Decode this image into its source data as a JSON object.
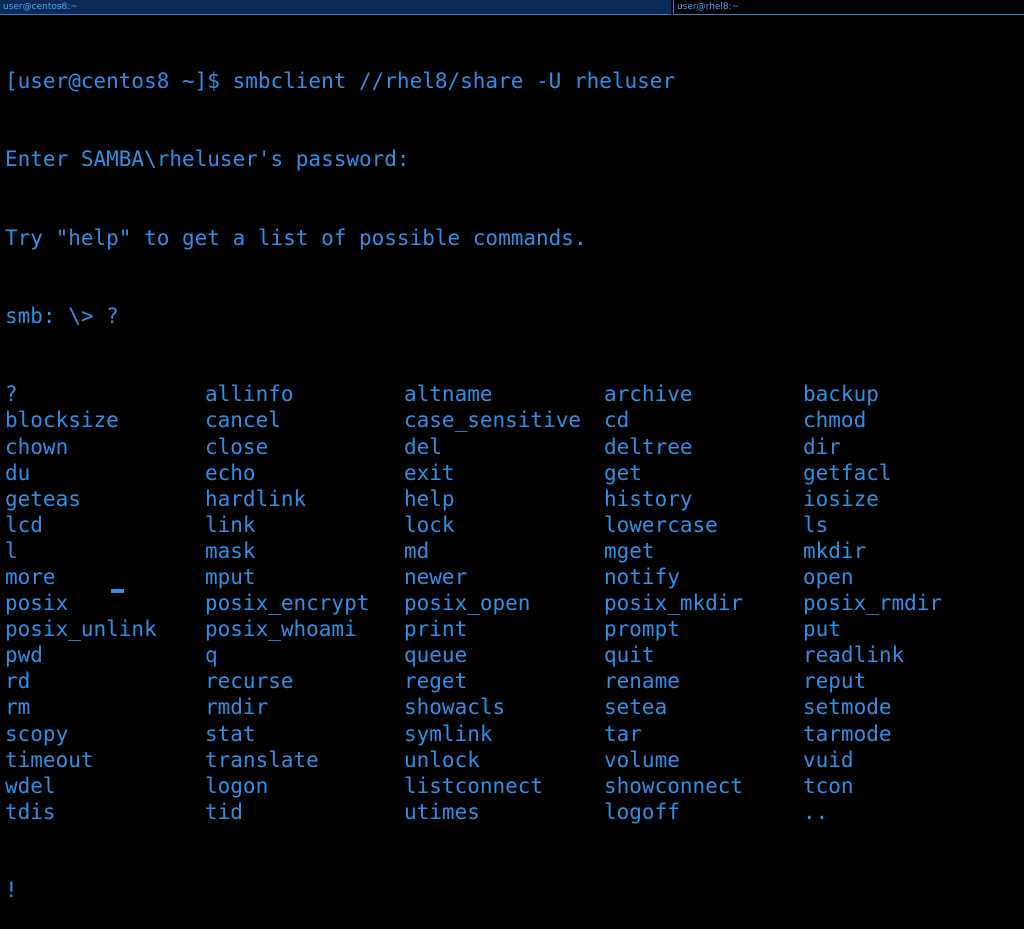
{
  "tabs": [
    {
      "label": "user@centos8:~",
      "active": true
    },
    {
      "label": "user@rhel8:~",
      "active": false
    }
  ],
  "terminal": {
    "lines": [
      "[user@centos8 ~]$ smbclient //rhel8/share -U rheluser",
      "Enter SAMBA\\rheluser's password:",
      "Try \"help\" to get a list of possible commands.",
      "smb: \\> ?"
    ],
    "commands": [
      [
        "?",
        "allinfo",
        "altname",
        "archive",
        "backup"
      ],
      [
        "blocksize",
        "cancel",
        "case_sensitive",
        "cd",
        "chmod"
      ],
      [
        "chown",
        "close",
        "del",
        "deltree",
        "dir"
      ],
      [
        "du",
        "echo",
        "exit",
        "get",
        "getfacl"
      ],
      [
        "geteas",
        "hardlink",
        "help",
        "history",
        "iosize"
      ],
      [
        "lcd",
        "link",
        "lock",
        "lowercase",
        "ls"
      ],
      [
        "l",
        "mask",
        "md",
        "mget",
        "mkdir"
      ],
      [
        "more",
        "mput",
        "newer",
        "notify",
        "open"
      ],
      [
        "posix",
        "posix_encrypt",
        "posix_open",
        "posix_mkdir",
        "posix_rmdir"
      ],
      [
        "posix_unlink",
        "posix_whoami",
        "print",
        "prompt",
        "put"
      ],
      [
        "pwd",
        "q",
        "queue",
        "quit",
        "readlink"
      ],
      [
        "rd",
        "recurse",
        "reget",
        "rename",
        "reput"
      ],
      [
        "rm",
        "rmdir",
        "showacls",
        "setea",
        "setmode"
      ],
      [
        "scopy",
        "stat",
        "symlink",
        "tar",
        "tarmode"
      ],
      [
        "timeout",
        "translate",
        "unlock",
        "volume",
        "vuid"
      ],
      [
        "wdel",
        "logon",
        "listconnect",
        "showconnect",
        "tcon"
      ],
      [
        "tdis",
        "tid",
        "utimes",
        "logoff",
        ".."
      ]
    ],
    "last_line": "!",
    "text_color": "#2f8fe6",
    "background": "#000000"
  }
}
